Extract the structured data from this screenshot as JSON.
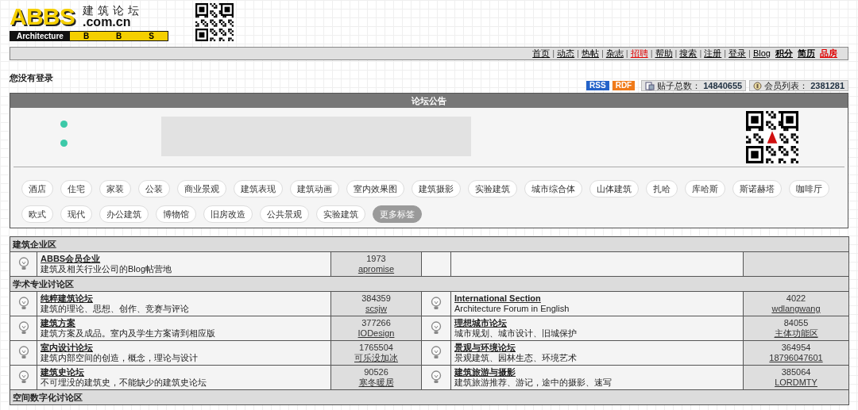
{
  "logo": {
    "mark": "ABBS",
    "cn": "建筑论坛",
    "domain": ".com.cn",
    "tagline": "Architecture",
    "bbs": [
      "B",
      "B",
      "S"
    ]
  },
  "nav": [
    {
      "label": "首页",
      "color": "#000000",
      "bold": false,
      "separator": "|"
    },
    {
      "label": "动态",
      "color": "#000000",
      "bold": false,
      "separator": "|"
    },
    {
      "label": "热帖",
      "color": "#000000",
      "bold": false,
      "separator": "|"
    },
    {
      "label": "杂志",
      "color": "#000000",
      "bold": false,
      "separator": "|"
    },
    {
      "label": "招聘",
      "color": "#e00000",
      "bold": false,
      "separator": "|"
    },
    {
      "label": "帮助",
      "color": "#000000",
      "bold": false,
      "separator": "|"
    },
    {
      "label": "搜索",
      "color": "#000000",
      "bold": false,
      "separator": "|"
    },
    {
      "label": "注册",
      "color": "#000000",
      "bold": false,
      "separator": "|"
    },
    {
      "label": "登录",
      "color": "#000000",
      "bold": false,
      "separator": "|"
    },
    {
      "label": "Blog",
      "color": "#000000",
      "bold": false
    },
    {
      "label": "积分",
      "color": "#000000",
      "bold": true
    },
    {
      "label": "简历",
      "color": "#000000",
      "bold": true
    },
    {
      "label": "品房",
      "color": "#e00000",
      "bold": true
    }
  ],
  "login_status": "您没有登录",
  "feeds": [
    "RSS",
    "RDF"
  ],
  "stats": [
    {
      "label": "贴子总数：",
      "value": "14840655"
    },
    {
      "label": "会员列表：",
      "value": "2381281"
    }
  ],
  "announcement": {
    "title": "论坛公告",
    "tags": [
      {
        "label": "酒店",
        "kind": "tag"
      },
      {
        "label": "住宅",
        "kind": "tag"
      },
      {
        "label": "家装",
        "kind": "tag"
      },
      {
        "label": "公装",
        "kind": "tag"
      },
      {
        "label": "商业景观",
        "kind": "tag"
      },
      {
        "label": "建筑表现",
        "kind": "tag"
      },
      {
        "label": "建筑动画",
        "kind": "tag"
      },
      {
        "label": "室内效果图",
        "kind": "tag"
      },
      {
        "label": "建筑摄影",
        "kind": "tag"
      },
      {
        "label": "实验建筑",
        "kind": "tag"
      },
      {
        "label": "城市综合体",
        "kind": "tag"
      },
      {
        "label": "山体建筑",
        "kind": "tag"
      },
      {
        "label": "扎哈",
        "kind": "tag"
      },
      {
        "label": "库哈斯",
        "kind": "tag"
      },
      {
        "label": "斯诺赫塔",
        "kind": "tag"
      },
      {
        "label": "咖啡厅",
        "kind": "tag"
      },
      {
        "label": "欧式",
        "kind": "tag"
      },
      {
        "label": "现代",
        "kind": "tag"
      },
      {
        "label": "办公建筑",
        "kind": "tag"
      },
      {
        "label": "博物馆",
        "kind": "tag"
      },
      {
        "label": "旧房改造",
        "kind": "tag"
      },
      {
        "label": "公共景观",
        "kind": "tag"
      },
      {
        "label": "实验建筑",
        "kind": "tag"
      },
      {
        "label": "更多标签",
        "kind": "more"
      }
    ]
  },
  "sections": [
    {
      "title": "建筑企业区",
      "rows": [
        {
          "left": {
            "name": "ABBS会员企业",
            "desc": "建筑及相关行业公司的Blog帖营地",
            "posts": "1973",
            "last_user": "apromise"
          }
        }
      ]
    },
    {
      "title": "学术专业讨论区",
      "rows": [
        {
          "left": {
            "name": "纯粹建筑论坛",
            "desc": "建筑的理论、思想、创作、竞赛与评论",
            "posts": "384359",
            "last_user": "scsjw"
          },
          "right": {
            "name": "International Section",
            "desc": "Architecture Forum in English",
            "posts": "4022",
            "last_user": "wdlangwang"
          }
        },
        {
          "left": {
            "name": "建筑方案",
            "desc": "建筑方案及成品。室内及学生方案请到相应版",
            "posts": "377266",
            "last_user": "IODesign"
          },
          "right": {
            "name": "理想城市论坛",
            "desc": "城市规划、城市设计、旧城保护",
            "posts": "84055",
            "last_user": "主体功能区"
          }
        },
        {
          "left": {
            "name": "室内设计论坛",
            "desc": "建筑内部空间的创造，概念，理论与设计",
            "posts": "1765504",
            "last_user": "可乐没加冰"
          },
          "right": {
            "name": "景观与环境论坛",
            "desc": "景观建筑、园林生态、环境艺术",
            "posts": "364954",
            "last_user": "18796047601"
          }
        },
        {
          "left": {
            "name": "建筑史论坛",
            "desc": "不可埋没的建筑史，不能缺少的建筑史论坛",
            "posts": "90526",
            "last_user": "寒冬暖居"
          },
          "right": {
            "name": "建筑旅游与摄影",
            "desc": "建筑旅游推荐、游记，途中的摄影、速写",
            "posts": "385064",
            "last_user": "LORDMTY"
          }
        }
      ]
    },
    {
      "title": "空间数字化讨论区"
    }
  ]
}
